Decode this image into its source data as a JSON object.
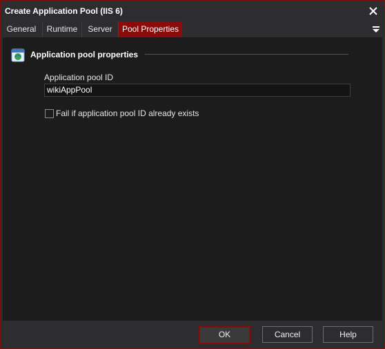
{
  "window": {
    "title": "Create Application Pool (IIS 6)"
  },
  "tabs": [
    {
      "label": "General"
    },
    {
      "label": "Runtime"
    },
    {
      "label": "Server"
    },
    {
      "label": "Pool Properties",
      "active": true
    }
  ],
  "section": {
    "title": "Application pool properties",
    "icon": "iis-globe-icon"
  },
  "form": {
    "pool_id_label": "Application pool ID",
    "pool_id_value": "wikiAppPool",
    "fail_if_exists_label": "Fail if application pool ID already exists",
    "fail_if_exists_checked": false
  },
  "buttons": {
    "ok": "OK",
    "cancel": "Cancel",
    "help": "Help"
  },
  "colors": {
    "accent": "#8b0a0a",
    "background": "#1c1c1c",
    "chrome": "#2d2d30"
  }
}
